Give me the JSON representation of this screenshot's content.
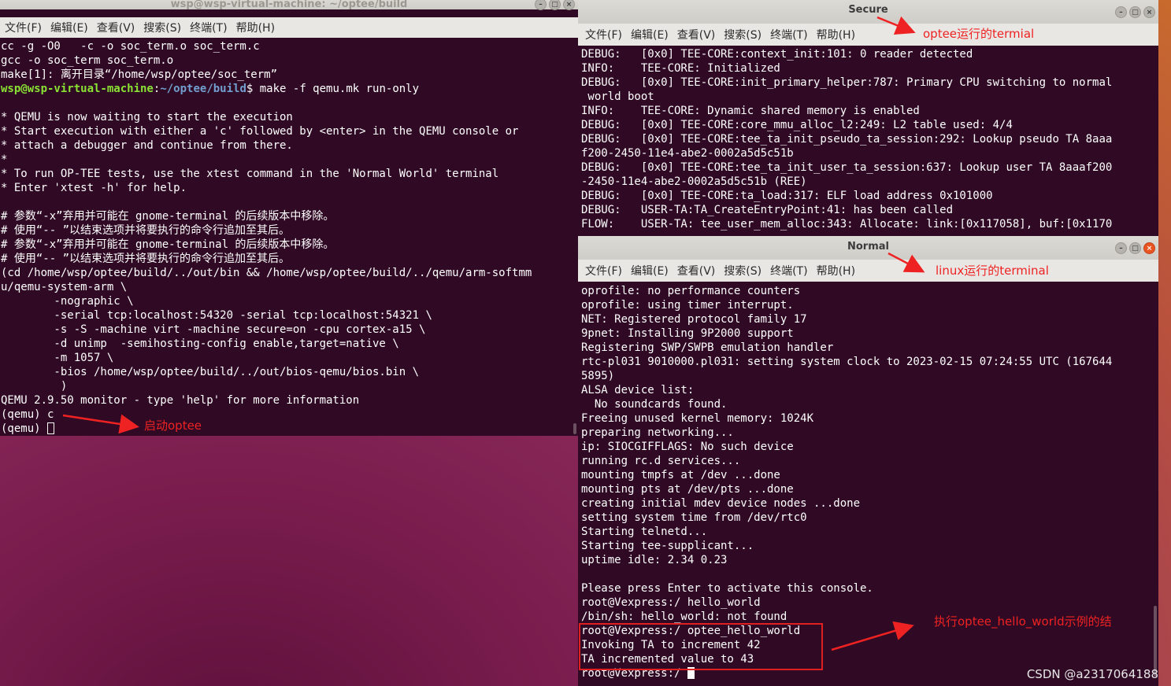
{
  "left_window": {
    "title": "wsp@wsp-virtual-machine: ~/optee/build",
    "menu": [
      "文件(F)",
      "编辑(E)",
      "查看(V)",
      "搜索(S)",
      "终端(T)",
      "帮助(H)"
    ],
    "lines": [
      "cc -g -O0   -c -o soc_term.o soc_term.c",
      "gcc -o soc_term soc_term.o",
      "make[1]: 离开目录“/home/wsp/optee/soc_term”",
      {
        "prompt_user": "wsp@wsp-virtual-machine",
        "prompt_sep": ":",
        "prompt_path": "~/optee/build",
        "prompt_end": "$ ",
        "command": "make -f qemu.mk run-only"
      },
      "",
      "* QEMU is now waiting to start the execution",
      "* Start execution with either a 'c' followed by <enter> in the QEMU console or",
      "* attach a debugger and continue from there.",
      "*",
      "* To run OP-TEE tests, use the xtest command in the 'Normal World' terminal",
      "* Enter 'xtest -h' for help.",
      "",
      "# 参数“-x”弃用并可能在 gnome-terminal 的后续版本中移除。",
      "# 使用“-- ”以结束选项并将要执行的命令行追加至其后。",
      "# 参数“-x”弃用并可能在 gnome-terminal 的后续版本中移除。",
      "# 使用“-- ”以结束选项并将要执行的命令行追加至其后。",
      "(cd /home/wsp/optee/build/../out/bin && /home/wsp/optee/build/../qemu/arm-softmm",
      "u/qemu-system-arm \\",
      "        -nographic \\",
      "        -serial tcp:localhost:54320 -serial tcp:localhost:54321 \\",
      "        -s -S -machine virt -machine secure=on -cpu cortex-a15 \\",
      "        -d unimp  -semihosting-config enable,target=native \\",
      "        -m 1057 \\",
      "        -bios /home/wsp/optee/build/../out/bios-qemu/bios.bin \\",
      "         )",
      "QEMU 2.9.50 monitor - type 'help' for more information",
      "(qemu) c",
      {
        "text": "(qemu) ",
        "cursor": "box"
      }
    ]
  },
  "secure_window": {
    "title": "Secure",
    "menu": [
      "文件(F)",
      "编辑(E)",
      "查看(V)",
      "搜索(S)",
      "终端(T)",
      "帮助(H)"
    ],
    "lines": [
      "DEBUG:   [0x0] TEE-CORE:context_init:101: 0 reader detected",
      "INFO:    TEE-CORE: Initialized",
      "DEBUG:   [0x0] TEE-CORE:init_primary_helper:787: Primary CPU switching to normal",
      " world boot",
      "INFO:    TEE-CORE: Dynamic shared memory is enabled",
      "DEBUG:   [0x0] TEE-CORE:core_mmu_alloc_l2:249: L2 table used: 4/4",
      "DEBUG:   [0x0] TEE-CORE:tee_ta_init_pseudo_ta_session:292: Lookup pseudo TA 8aaa",
      "f200-2450-11e4-abe2-0002a5d5c51b",
      "DEBUG:   [0x0] TEE-CORE:tee_ta_init_user_ta_session:637: Lookup user TA 8aaaf200",
      "-2450-11e4-abe2-0002a5d5c51b (REE)",
      "DEBUG:   [0x0] TEE-CORE:ta_load:317: ELF load address 0x101000",
      "DEBUG:   USER-TA:TA_CreateEntryPoint:41: has been called",
      "FLOW:    USER-TA: tee_user_mem_alloc:343: Allocate: link:[0x117058], buf:[0x1170"
    ]
  },
  "normal_window": {
    "title": "Normal",
    "menu": [
      "文件(F)",
      "编辑(E)",
      "查看(V)",
      "搜索(S)",
      "终端(T)",
      "帮助(H)"
    ],
    "lines": [
      "oprofile: no performance counters",
      "oprofile: using timer interrupt.",
      "NET: Registered protocol family 17",
      "9pnet: Installing 9P2000 support",
      "Registering SWP/SWPB emulation handler",
      "rtc-pl031 9010000.pl031: setting system clock to 2023-02-15 07:24:55 UTC (167644",
      "5895)",
      "ALSA device list:",
      "  No soundcards found.",
      "Freeing unused kernel memory: 1024K",
      "preparing networking...",
      "ip: SIOCGIFFLAGS: No such device",
      "running rc.d services...",
      "mounting tmpfs at /dev ...done",
      "mounting pts at /dev/pts ...done",
      "creating initial mdev device nodes ...done",
      "setting system time from /dev/rtc0",
      "Starting telnetd...",
      "Starting tee-supplicant...",
      "uptime idle: 2.34 0.23",
      "",
      "Please press Enter to activate this console.",
      "root@Vexpress:/ hello_world",
      "/bin/sh: hello_world: not found",
      "root@Vexpress:/ optee_hello_world",
      "Invoking TA to increment 42",
      "TA incremented value to 43",
      {
        "text": "root@Vexpress:/ ",
        "cursor": "solid"
      }
    ]
  },
  "annotations": {
    "start_optee": "启动optee",
    "optee_terminal": "optee运行的termial",
    "linux_terminal": "linux运行的terminal",
    "hello_world_result": "执行optee_hello_world示例的结"
  },
  "watermark": "CSDN @a2317064188",
  "colors": {
    "terminal_bg": "#300a24",
    "prompt_user": "#8ae234",
    "prompt_path": "#729fcf",
    "annotation_red": "#ee2222",
    "close_button": "#e95420"
  }
}
